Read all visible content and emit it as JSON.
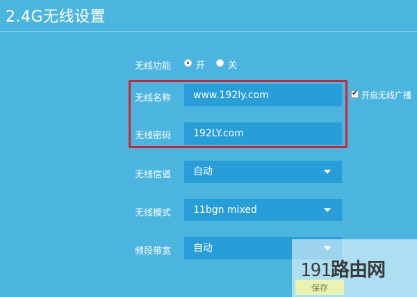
{
  "page": {
    "title": "2.4G无线设置"
  },
  "wireless_function": {
    "label": "无线功能",
    "options": [
      {
        "label": "开",
        "selected": true
      },
      {
        "label": "关",
        "selected": false
      }
    ]
  },
  "ssid": {
    "label": "无线名称",
    "value": "www.192ly.com"
  },
  "broadcast": {
    "label": "开启无线广播",
    "checked": true
  },
  "password": {
    "label": "无线密码",
    "value": "192LY.com"
  },
  "channel": {
    "label": "无线信道",
    "value": "自动"
  },
  "mode": {
    "label": "无线模式",
    "value": "11bgn mixed"
  },
  "bandwidth": {
    "label": "频段带宽",
    "value": "自动"
  },
  "save": {
    "label": "保存"
  },
  "watermark": {
    "digits": "191",
    "text": "路由网"
  },
  "colors": {
    "background": "#4cb5df",
    "field": "#279ed8",
    "highlight": "#d8202a"
  }
}
